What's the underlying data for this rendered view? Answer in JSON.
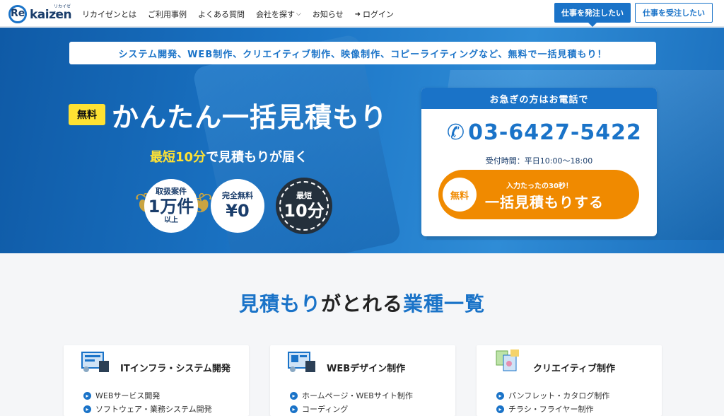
{
  "header": {
    "logo_re": "Re",
    "logo_kaizen": "kaizen",
    "logo_ruby": "リカイゼン",
    "nav": [
      "リカイゼンとは",
      "ご利用事例",
      "よくある質問",
      "会社を探す",
      "お知らせ",
      "ログイン"
    ],
    "post_button": "仕事を発注したい",
    "receive_button": "仕事を受注したい"
  },
  "hero": {
    "banner": "システム開発、WEB制作、クリエイティブ制作、映像制作、コピーライティングなど、無料で一括見積もり！",
    "free_tag": "無料",
    "headline_a": "かんたん",
    "headline_b": "一括見積もり",
    "sub_a": "最短10分",
    "sub_b": "で見積もりが届く",
    "badge1": {
      "top": "取扱案件",
      "mid": "1万件",
      "bottom": "以上"
    },
    "badge2": {
      "top": "完全無料",
      "mid": "¥0"
    },
    "badge3": {
      "top": "最短",
      "mid": "10分"
    }
  },
  "contact": {
    "heading": "お急ぎの方はお電話で",
    "phone": "03-6427-5422",
    "hours": "受付時間：平日10:00〜18:00",
    "cta_free": "無料",
    "cta_small": "入力たったの30秒！",
    "cta_main": "一括見積もりする"
  },
  "section": {
    "title_a": "見積もり",
    "title_b": "がとれる",
    "title_c": "業種一覧",
    "cards": [
      {
        "title": "ITインフラ・システム開発",
        "items": [
          "WEBサービス開発",
          "ソフトウェア・業務システム開発"
        ]
      },
      {
        "title": "WEBデザイン制作",
        "items": [
          "ホームページ・WEBサイト制作",
          "コーディング"
        ]
      },
      {
        "title": "クリエイティブ制作",
        "items": [
          "パンフレット・カタログ制作",
          "チラシ・フライヤー制作"
        ]
      }
    ]
  },
  "colors": {
    "brand": "#1a73c8",
    "accent": "#f08a00",
    "highlight": "#ffe233"
  }
}
